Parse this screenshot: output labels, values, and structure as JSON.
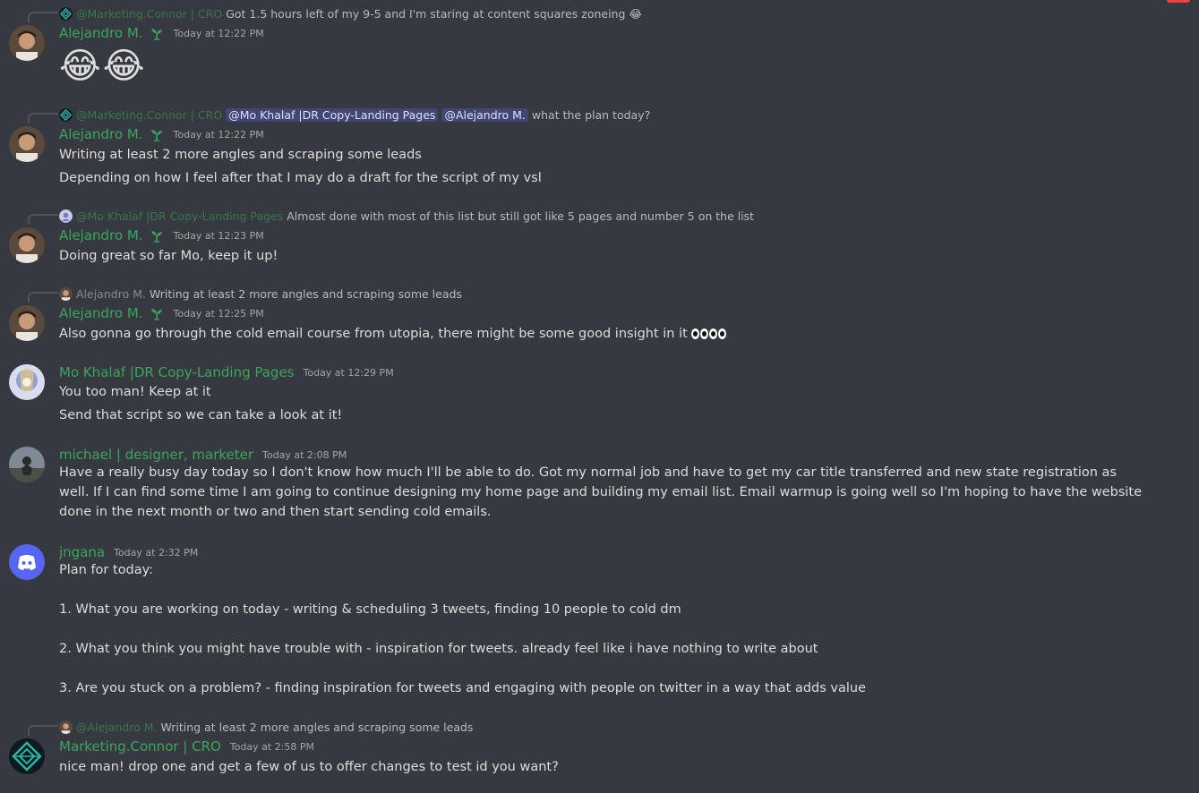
{
  "messages": [
    {
      "reply": {
        "name": "@Marketing.Connor | CRO",
        "text": "Got 1.5 hours left of my 9-5 and I'm staring at content squares zoneing",
        "emoji": "😂"
      },
      "author": "Alejandro M.",
      "time": "Today at 12:22 PM",
      "big_emoji": [
        "😂",
        "😂"
      ]
    },
    {
      "reply": {
        "name": "@Marketing.Connor | CRO",
        "mentions": [
          "@Mo Khalaf |DR Copy-Landing Pages",
          "@Alejandro M."
        ],
        "text": "what the plan today?"
      },
      "author": "Alejandro M.",
      "time": "Today at 12:22 PM",
      "lines": [
        "Writing at least 2 more angles and scraping some leads",
        "Depending on how I feel after that I may do a draft for the script of my vsl"
      ]
    },
    {
      "reply": {
        "name": "@Mo Khalaf |DR Copy-Landing Pages",
        "text": "Almost done with most of this list but still got like 5 pages and number 5 on the list"
      },
      "author": "Alejandro M.",
      "time": "Today at 12:23 PM",
      "lines": [
        "Doing great so far Mo, keep it up!"
      ]
    },
    {
      "reply": {
        "name": "Alejandro M.",
        "text": "Writing at least 2 more angles and scraping some leads"
      },
      "author": "Alejandro M.",
      "time": "Today at 12:25 PM",
      "lines": [
        "Also gonna go through the cold email course from utopia, there might be some good insight in it"
      ]
    },
    {
      "author": "Mo Khalaf |DR Copy-Landing Pages",
      "time": "Today at 12:29 PM",
      "lines": [
        "You too man! Keep at it",
        "Send that script so we can take a look at it!"
      ]
    },
    {
      "author": "michael | designer, marketer",
      "time": "Today at 2:08 PM",
      "lines": [
        "Have a really busy day today so I don't know how much I'll be able to do. Got my normal job and have to get my car title transferred and new state registration as well. If I can find some time I am going to continue designing my home page and building my email list. Email warmup is going well so I'm hoping to have the website done in the next month or two and then start sending cold emails."
      ]
    },
    {
      "author": "jngana",
      "time": "Today at 2:32 PM",
      "lines": [
        "Plan for today:",
        "1. What you are working on today - writing & scheduling 3 tweets, finding 10 people to cold dm",
        "2. What you think you might have trouble with - inspiration for tweets. already feel like i have nothing to write about",
        "3. Are you stuck on a problem? - finding inspiration for tweets and engaging with people on twitter in a way that adds value"
      ]
    },
    {
      "reply": {
        "name": "@Alejandro M.",
        "text": "Writing at least 2 more angles and scraping some leads"
      },
      "author": "Marketing.Connor | CRO",
      "time": "Today at 2:58 PM",
      "lines": [
        "nice man! drop one and get a few of us to offer changes to test id you want?"
      ]
    }
  ],
  "colors": {
    "username": "#3ba55d",
    "mention_bg": "#414675",
    "background": "#36393f",
    "text": "#dcddde"
  },
  "icons": {
    "badge": "sprout-icon",
    "discord": "discord-icon",
    "connor_logo": "diamond-logo-icon"
  }
}
